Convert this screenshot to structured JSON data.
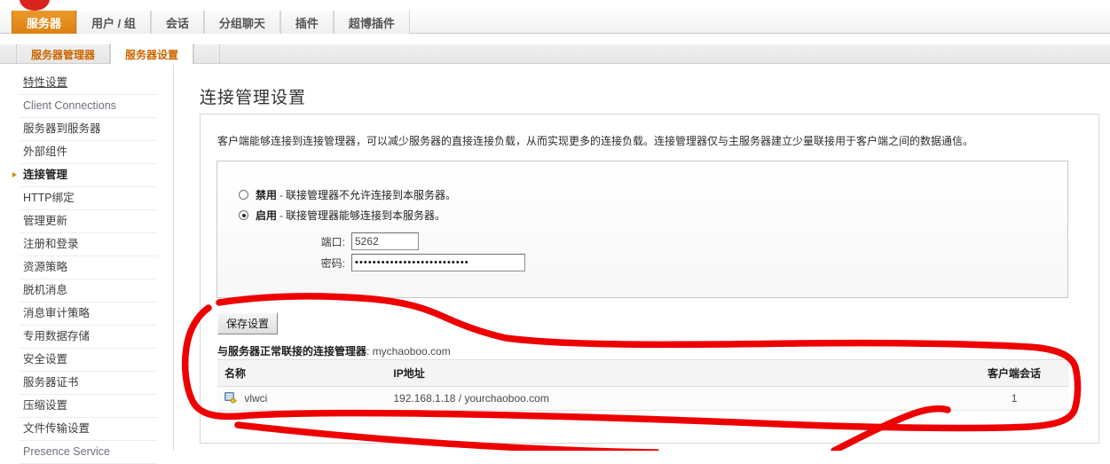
{
  "topbar": {
    "tabs": [
      {
        "label": "服务器",
        "active": true
      },
      {
        "label": "用户 / 组",
        "active": false
      },
      {
        "label": "会话",
        "active": false
      },
      {
        "label": "分组聊天",
        "active": false
      },
      {
        "label": "插件",
        "active": false
      },
      {
        "label": "超博插件",
        "active": false
      }
    ]
  },
  "subbar": {
    "tabs": [
      {
        "label": "服务器管理器",
        "active": false
      },
      {
        "label": "服务器设置",
        "active": true
      }
    ]
  },
  "sidebar": {
    "items": [
      {
        "label": "特性设置",
        "active": false,
        "latin": false,
        "underline": true
      },
      {
        "label": "Client Connections",
        "active": false,
        "latin": true,
        "underline": false
      },
      {
        "label": "服务器到服务器",
        "active": false,
        "latin": false,
        "underline": false
      },
      {
        "label": "外部组件",
        "active": false,
        "latin": false,
        "underline": false
      },
      {
        "label": "连接管理",
        "active": true,
        "latin": false,
        "underline": false
      },
      {
        "label": "HTTP绑定",
        "active": false,
        "latin": false,
        "underline": false
      },
      {
        "label": "管理更新",
        "active": false,
        "latin": false,
        "underline": false
      },
      {
        "label": "注册和登录",
        "active": false,
        "latin": false,
        "underline": false
      },
      {
        "label": "资源策略",
        "active": false,
        "latin": false,
        "underline": false
      },
      {
        "label": "脱机消息",
        "active": false,
        "latin": false,
        "underline": false
      },
      {
        "label": "消息审计策略",
        "active": false,
        "latin": false,
        "underline": false
      },
      {
        "label": "专用数据存储",
        "active": false,
        "latin": false,
        "underline": false
      },
      {
        "label": "安全设置",
        "active": false,
        "latin": false,
        "underline": false
      },
      {
        "label": "服务器证书",
        "active": false,
        "latin": false,
        "underline": false
      },
      {
        "label": "压缩设置",
        "active": false,
        "latin": false,
        "underline": false
      },
      {
        "label": "文件传输设置",
        "active": false,
        "latin": false,
        "underline": false
      },
      {
        "label": "Presence Service",
        "active": false,
        "latin": true,
        "underline": false
      }
    ]
  },
  "main": {
    "page_title": "连接管理设置",
    "description": "客户端能够连接到连接管理器，可以减少服务器的直接连接负载，从而实现更多的连接负载。连接管理器仅与主服务器建立少量联接用于客户端之间的数据通信。",
    "radio_options": [
      {
        "bold": "禁用",
        "sep": "-",
        "text": "联接管理器不允许连接到本服务器。",
        "checked": false
      },
      {
        "bold": "启用",
        "sep": "-",
        "text": "联接管理器能够连接到本服务器。",
        "checked": true
      }
    ],
    "fields": {
      "port_label": "端口:",
      "port_value": "5262",
      "password_label": "密码:",
      "password_value": "••••••••••••••••••••••••••",
      "password_placeholder": ""
    },
    "save_label": "保存设置",
    "connected_label": "与服务器正常联接的连接管理器",
    "connected_value": "mychaoboo.com",
    "table": {
      "headers": [
        "名称",
        "IP地址",
        "客户端会话"
      ],
      "rows": [
        {
          "icon": "server-key-icon",
          "name": "vlwci",
          "ip": "192.168.1.18 / yourchaoboo.com",
          "sessions": "1"
        }
      ]
    }
  },
  "annotation": {
    "color": "#ee0000",
    "description": "hand-drawn red circle highlighting the connection manager table"
  },
  "colors": {
    "accent_orange": "#dd8012",
    "subtab_text": "#cc6600",
    "annotation_red": "#ee0000",
    "logo_red": "#d8241f"
  }
}
